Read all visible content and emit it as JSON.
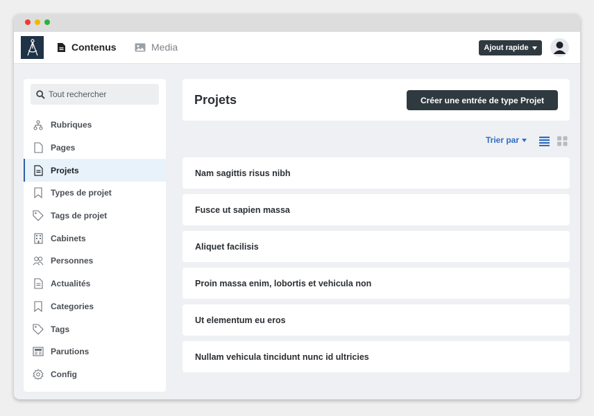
{
  "window": {
    "controls": [
      "close",
      "minimize",
      "maximize"
    ]
  },
  "appbar": {
    "nav": [
      {
        "label": "Contenus",
        "icon": "document-icon",
        "active": true
      },
      {
        "label": "Media",
        "icon": "image-icon",
        "active": false
      }
    ],
    "quick_add_label": "Ajout rapide",
    "avatar_icon": "user-icon"
  },
  "sidebar": {
    "search_placeholder": "Tout rechercher",
    "items": [
      {
        "label": "Rubriques",
        "icon": "hierarchy-icon"
      },
      {
        "label": "Pages",
        "icon": "page-icon"
      },
      {
        "label": "Projets",
        "icon": "document-icon",
        "active": true
      },
      {
        "label": "Types de projet",
        "icon": "bookmark-icon"
      },
      {
        "label": "Tags de projet",
        "icon": "tag-icon"
      },
      {
        "label": "Cabinets",
        "icon": "building-icon"
      },
      {
        "label": "Personnes",
        "icon": "people-icon"
      },
      {
        "label": "Actualités",
        "icon": "news-icon"
      },
      {
        "label": "Categories",
        "icon": "bookmark-icon"
      },
      {
        "label": "Tags",
        "icon": "tag-icon"
      },
      {
        "label": "Parutions",
        "icon": "newspaper-icon"
      },
      {
        "label": "Config",
        "icon": "gear-icon"
      }
    ]
  },
  "main": {
    "title": "Projets",
    "create_label": "Créer une entrée de type Projet",
    "sort_label": "Trier par",
    "view_mode": "list",
    "rows": [
      "Nam sagittis risus nibh",
      "Fusce ut sapien massa",
      "Aliquet facilisis",
      "Proin massa enim, lobortis et vehicula non",
      "Ut elementum eu eros",
      "Nullam vehicula tincidunt nunc id ultricies"
    ]
  },
  "colors": {
    "accent": "#2f6cc0",
    "dark_button": "#2f3a40",
    "active_bg": "#e8f2fb",
    "logo_bg": "#1f3246"
  }
}
